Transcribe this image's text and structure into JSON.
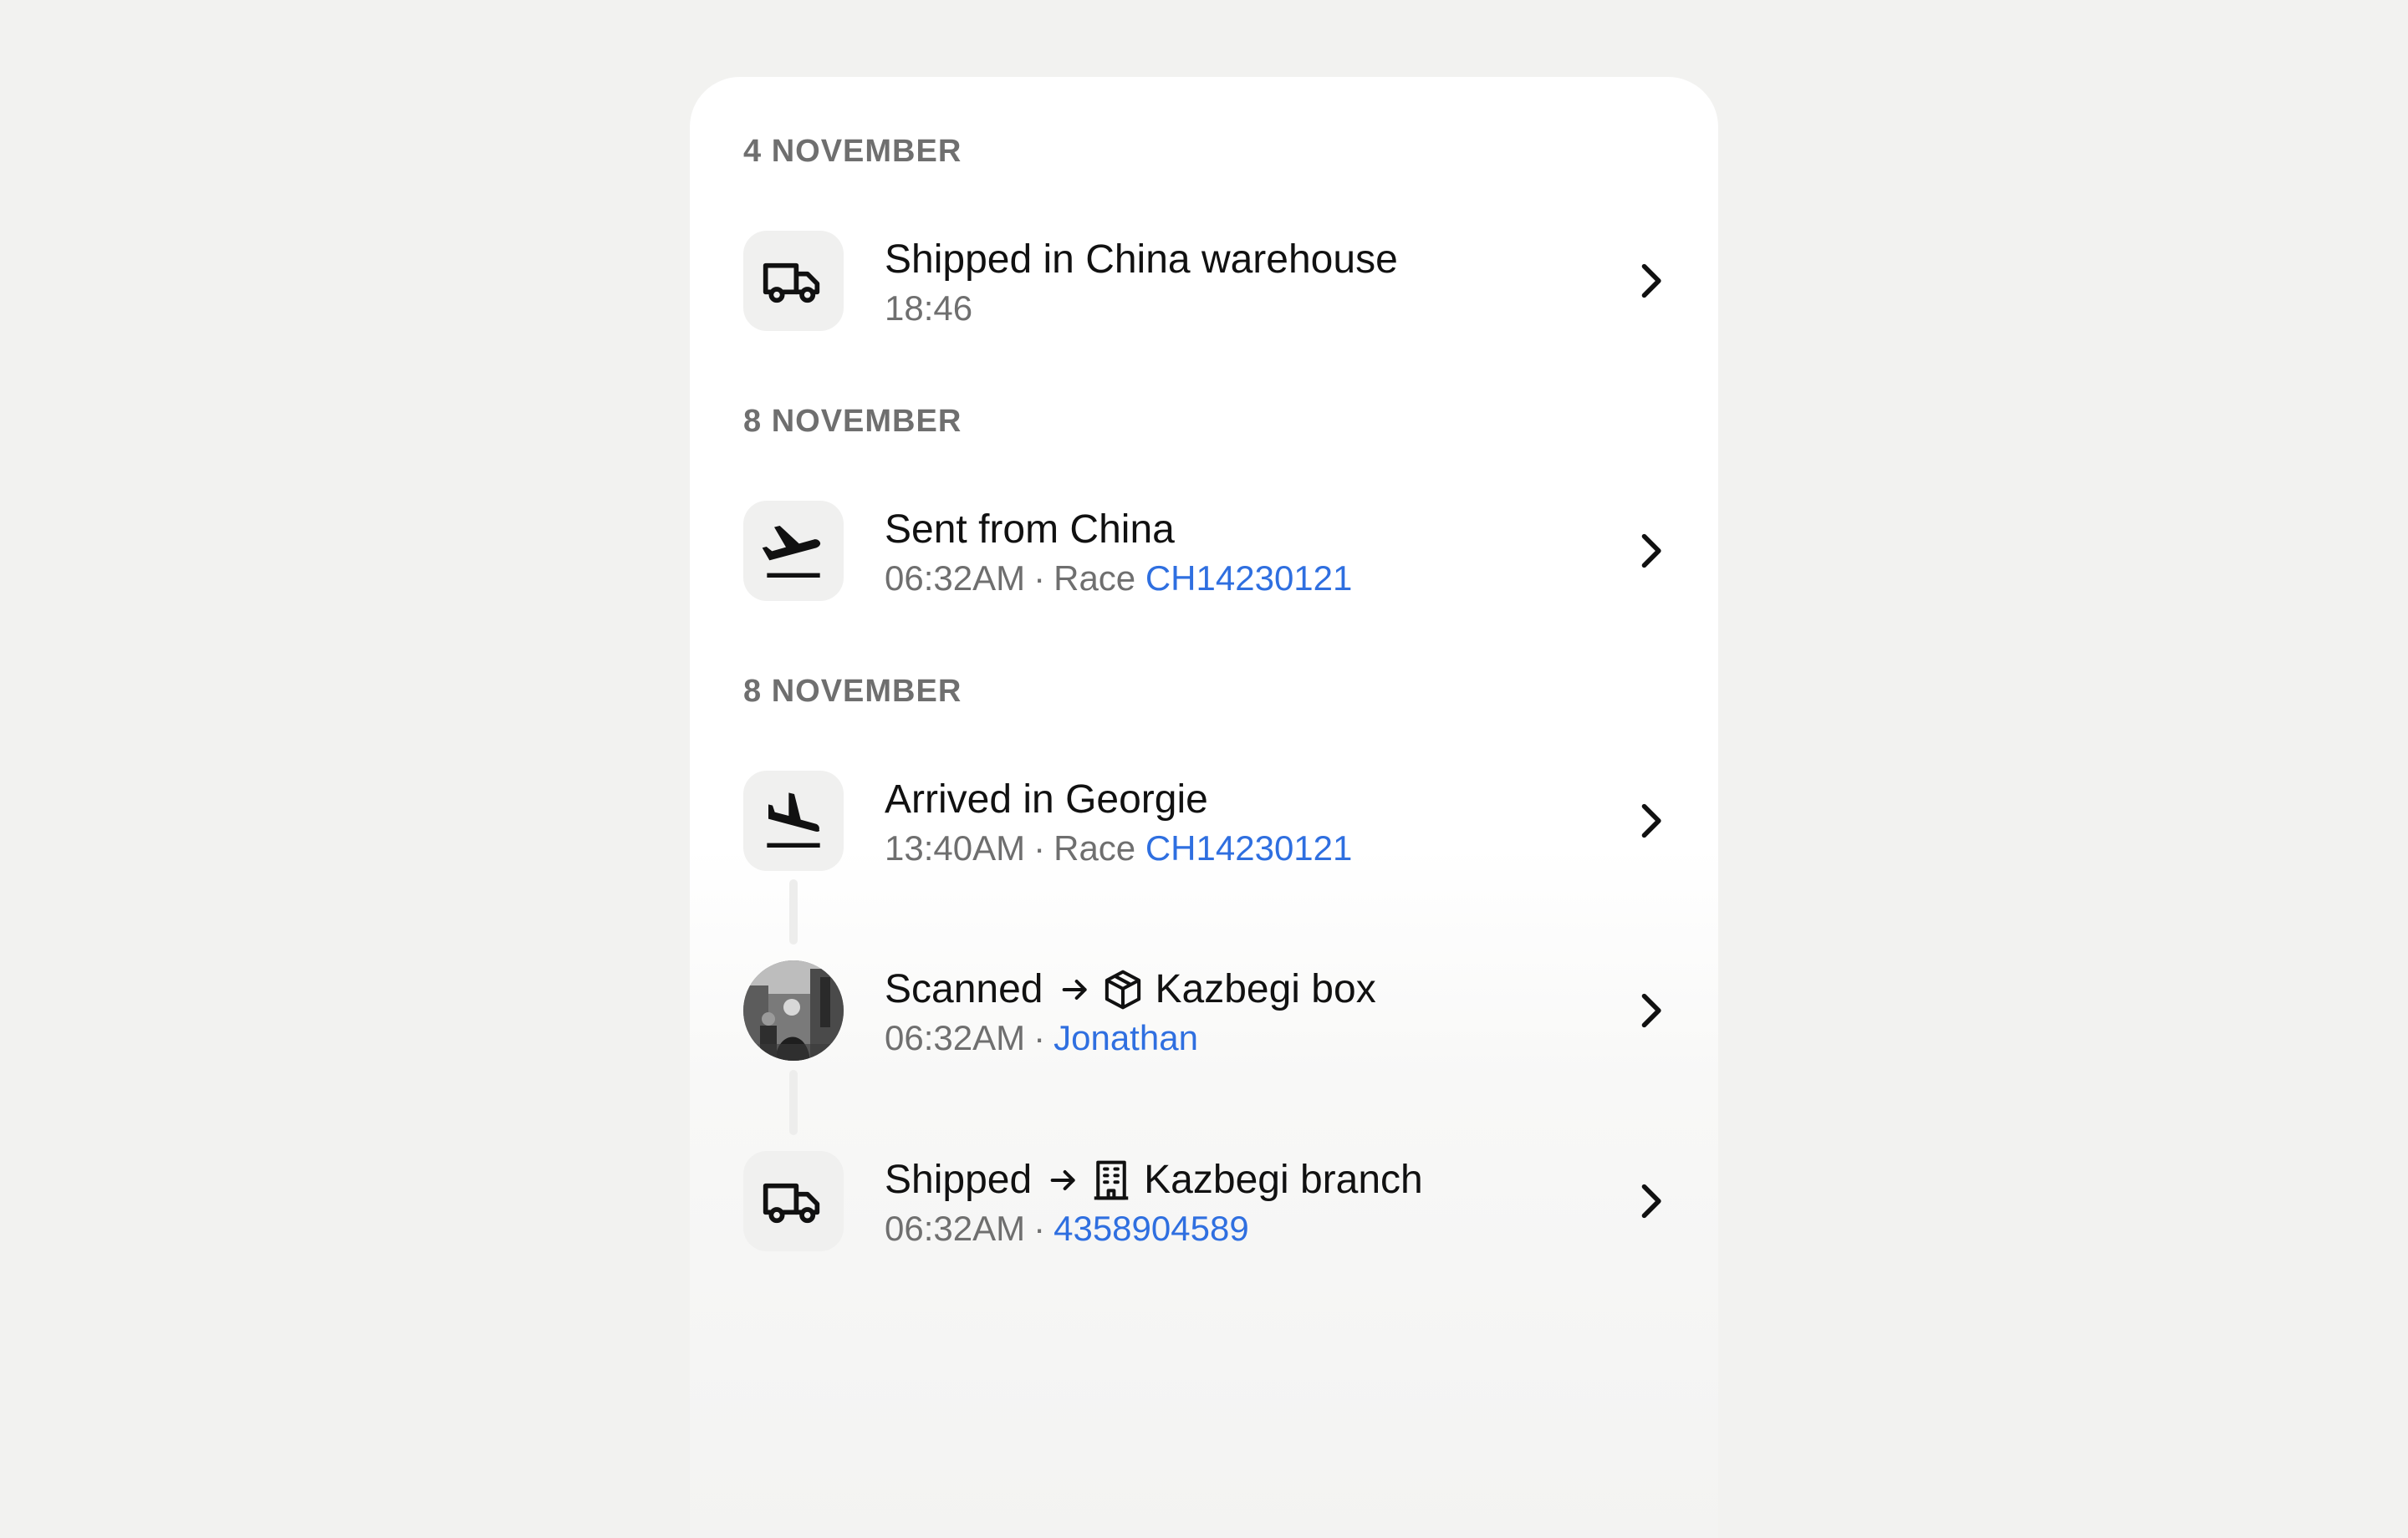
{
  "groups": [
    {
      "date": "4 NOVEMBER",
      "event": {
        "title": "Shipped in China warehouse",
        "time": "18:46",
        "icon": "truck-icon"
      }
    },
    {
      "date": "8 NOVEMBER",
      "event": {
        "title": "Sent from China",
        "time": "06:32AM",
        "label": "Race",
        "code": "CH14230121",
        "icon": "plane-departure-icon"
      }
    },
    {
      "date": "8 NOVEMBER",
      "events": [
        {
          "title": "Arrived in Georgie",
          "time": "13:40AM",
          "label": "Race",
          "code": "CH14230121",
          "icon": "plane-arrival-icon"
        },
        {
          "title_prefix": "Scanned",
          "title_target": "Kazbegi box",
          "time": "06:32AM",
          "person": "Jonathan",
          "icon": "box-icon"
        },
        {
          "title_prefix": "Shipped",
          "title_target": "Kazbegi branch",
          "time": "06:32AM",
          "tracking": "4358904589",
          "icon": "building-icon"
        }
      ]
    }
  ],
  "separator": "·",
  "colors": {
    "link": "#2f6fe0",
    "muted": "#6f6f6f",
    "tile": "#f0f0ef"
  }
}
